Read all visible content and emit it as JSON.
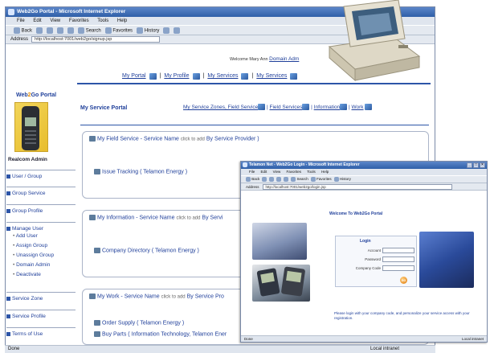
{
  "browser_back": {
    "title": "Web2Go Portal - Microsoft Internet Explorer",
    "menu": [
      "File",
      "Edit",
      "View",
      "Favorites",
      "Tools",
      "Help"
    ],
    "toolbar": {
      "back": "Back",
      "search": "Search",
      "favorites": "Favorites",
      "history": "History"
    },
    "address_label": "Address",
    "address_value": "http://localhost:7001/web2go/signup.jsp",
    "status_left": "Done",
    "status_right": "Local intranet"
  },
  "header": {
    "welcome_text": "Welcome Mary Ann",
    "welcome_link": "Domain Adm",
    "nav": [
      "My Portal",
      "My Profile",
      "My Services",
      "My Services"
    ]
  },
  "sidebar": {
    "brand_left": "Web",
    "brand_mid": "2",
    "brand_right": "Go Portal",
    "username": "Realcom Admin",
    "sections": [
      {
        "label": "User / Group"
      },
      {
        "label": "Group Service"
      },
      {
        "label": "Group Profile"
      },
      {
        "label": "Manage User",
        "sub": [
          "Add User",
          "Assign Group",
          "Unassign Group",
          "Domain Admin",
          "Deactivate"
        ]
      },
      {
        "label": "Service Zone"
      },
      {
        "label": "Service Profile"
      },
      {
        "label": "Terms of Use"
      }
    ]
  },
  "main": {
    "portal_title": "My Service Portal",
    "portal_nav": {
      "link1": "My Service Zones, Field Service",
      "link2": "Field Services",
      "link3": "Information",
      "link4": "Work"
    },
    "boxes": [
      {
        "header": "My Field Service - Service Name",
        "note": "click to add",
        "provider": "By Service Provider )",
        "items": [
          "Issue Tracking ( Telamon Energy )"
        ]
      },
      {
        "header": "My Information - Service Name",
        "note": "click to add",
        "provider": "By Servi",
        "items": [
          "Company Directory ( Telamon Energy )"
        ]
      },
      {
        "header": "My Work - Service Name",
        "note": "click to add",
        "provider": "By Service Pro",
        "items": [
          "Order Supply ( Telamon Energy )",
          "Buy Parts ( Information Technology, Telamon Ener"
        ]
      }
    ]
  },
  "browser_front": {
    "title": "Telamon Net - Web2Go Login - Microsoft Internet Explorer",
    "menu": [
      "File",
      "Edit",
      "View",
      "Favorites",
      "Tools",
      "Help"
    ],
    "toolbar": {
      "back": "Back",
      "search": "Search",
      "favorites": "Favorites",
      "history": "History"
    },
    "address_label": "Address",
    "address_value": "http://localhost:7001/web2go/login.jsp",
    "welcome": "Welcome To Web2Go Portal",
    "login": {
      "title": "Login",
      "account_label": "Account",
      "password_label": "Password",
      "company_label": "Company Code",
      "go_label": "GO"
    },
    "footer": "Please login with your company code, and personalize your service access with your registration.",
    "status_left": "Done",
    "status_right": "Local intranet"
  }
}
